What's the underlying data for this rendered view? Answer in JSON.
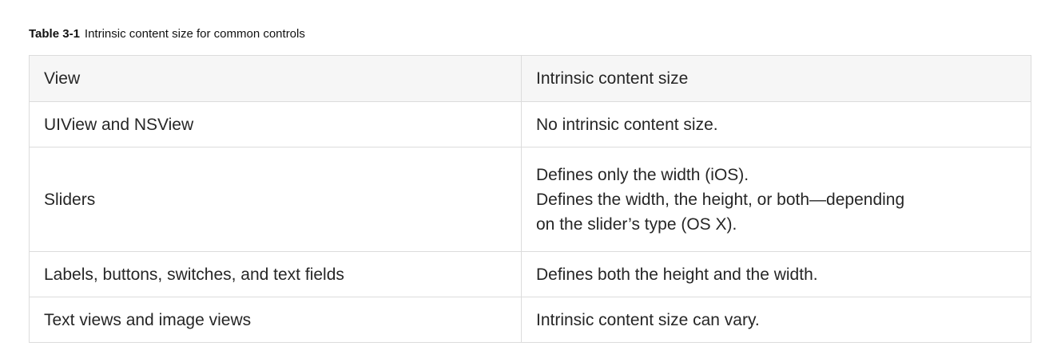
{
  "caption": {
    "label": "Table 3-1",
    "text": "Intrinsic content size for common controls"
  },
  "table": {
    "headers": [
      "View",
      "Intrinsic content size"
    ],
    "rows": [
      {
        "view": "UIView and NSView",
        "size_lines": [
          "No intrinsic content size."
        ]
      },
      {
        "view": "Sliders",
        "size_lines": [
          "Defines only the width (iOS).",
          "Defines the width, the height, or both—depending",
          "on the slider’s type (OS X)."
        ]
      },
      {
        "view": "Labels, buttons, switches, and text fields",
        "size_lines": [
          "Defines both the height and the width."
        ]
      },
      {
        "view": "Text views and image views",
        "size_lines": [
          "Intrinsic content size can vary."
        ]
      }
    ]
  }
}
